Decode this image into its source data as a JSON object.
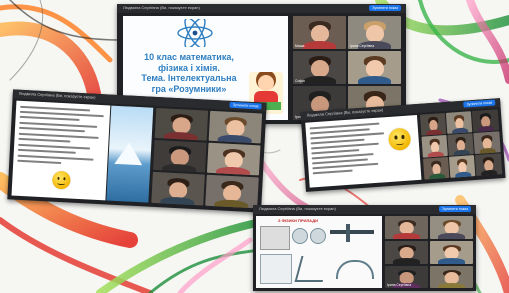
{
  "collage": {
    "shots": [
      {
        "title": "Людмила Сергіївна (Ви, показуєте екран)",
        "button": "Зупинити показ",
        "slide_title_lines": [
          "10 клас математика,",
          "фізика і хімія.",
          "Тема. Інтелектуальна",
          "гра «Розумники»"
        ],
        "participants": [
          "Маша",
          "Ірина Сергіївна",
          "Софія",
          "",
          "Ірина Купріянова",
          ""
        ]
      },
      {
        "title": "Людмила Сергіївна (Ви, показуєте екран)",
        "button": "Зупинити показ",
        "participants": [
          "",
          "",
          "",
          "",
          "",
          ""
        ]
      },
      {
        "title": "Людмила Сергіївна (Ви, показуєте екран)",
        "button": "Зупинити показ",
        "participants": [
          "",
          "",
          "",
          "",
          "",
          "",
          "",
          "",
          ""
        ]
      },
      {
        "title": "Людмила Сергіївна (Ви, показуєте екран)",
        "button": "Зупинити показ",
        "slide_caption": "З ФІЗИКИ ПРИЛАДИ",
        "participants": [
          "",
          "",
          "",
          "",
          "Ірина Сергіївна",
          ""
        ]
      }
    ]
  },
  "colors": {
    "accent_blue": "#1a73e8",
    "slide_title_blue": "#2f7fc1",
    "call_background": "#202124"
  },
  "icons": [
    "atom-icon",
    "cartoon-girl-icon",
    "thinking-emoji-icon",
    "iceberg-image",
    "lab-equipment-image"
  ]
}
